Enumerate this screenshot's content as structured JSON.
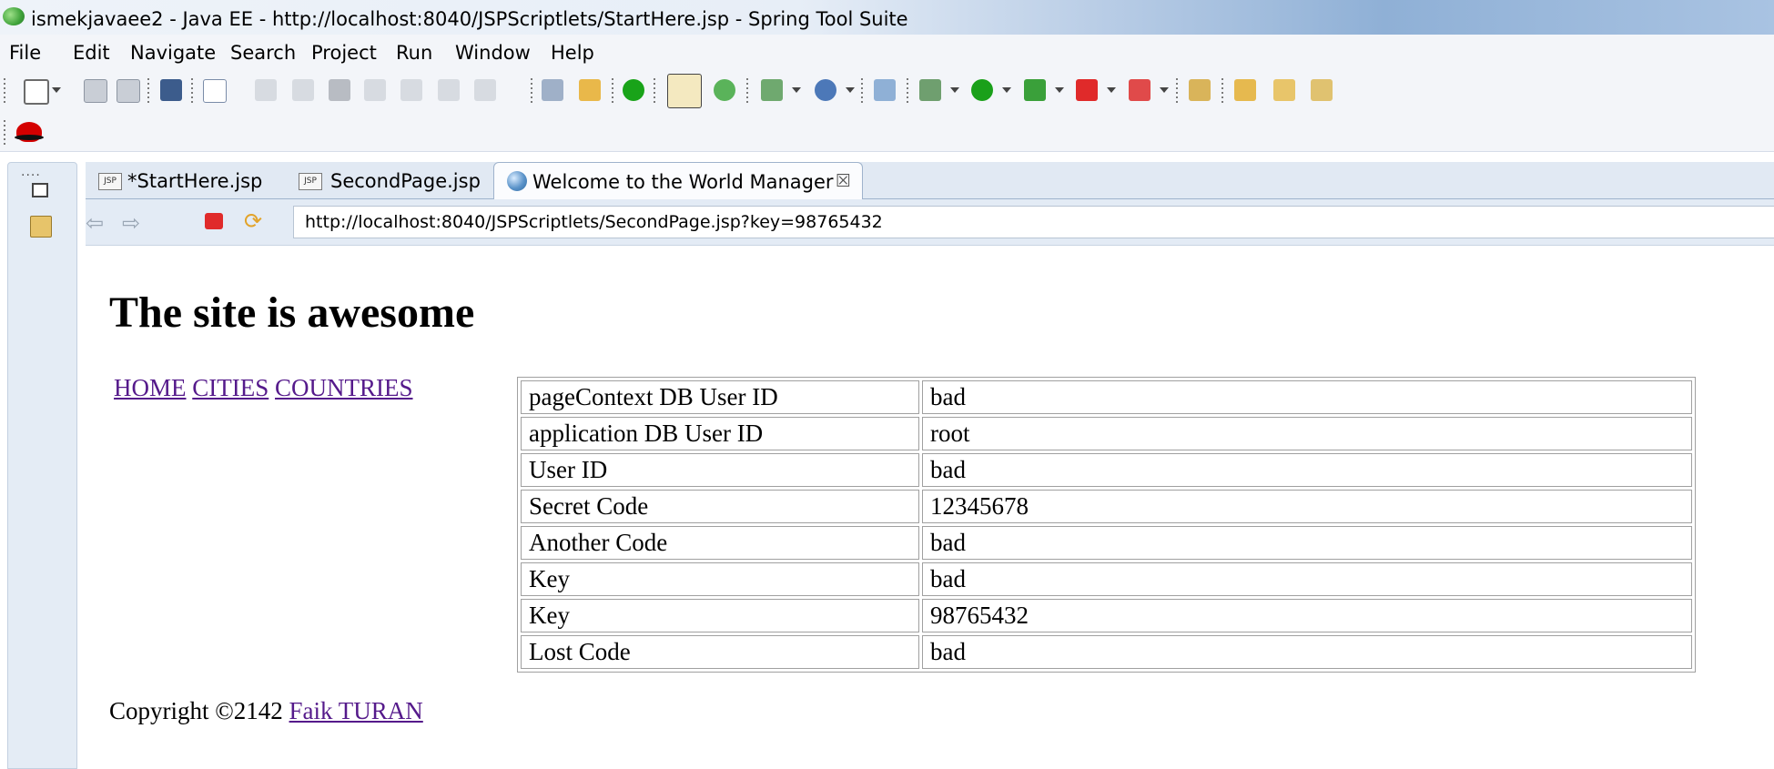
{
  "window": {
    "title": "ismekjavaee2 - Java EE - http://localhost:8040/JSPScriptlets/StartHere.jsp - Spring Tool Suite"
  },
  "menu": [
    "File",
    "Edit",
    "Navigate",
    "Search",
    "Project",
    "Run",
    "Window",
    "Help"
  ],
  "toolbar_icons": [
    "new-icon",
    "save-icon",
    "save-all-icon",
    "console-icon",
    "skip-breakpoints-icon",
    "resume-icon",
    "suspend-icon",
    "terminate-icon",
    "disconnect-icon",
    "step-into-icon",
    "step-over-icon",
    "step-return-icon",
    "drop-to-frame-icon",
    "use-step-filters-icon",
    "start-server-icon",
    "toggle-mark-occurrences-icon",
    "spring-icon",
    "new-spring-project-icon",
    "spring-dropdown-icon",
    "search-icon",
    "debug-icon",
    "run-icon",
    "coverage-icon",
    "stop-icon",
    "external-tools-icon",
    "open-type-icon",
    "open-folder-icon",
    "open-task-icon",
    "pin-icon",
    "redhat-icon"
  ],
  "tabs": [
    {
      "label": "*StartHere.jsp",
      "icon": "jsp-file-icon",
      "active": false
    },
    {
      "label": "SecondPage.jsp",
      "icon": "jsp-file-icon",
      "active": false
    },
    {
      "label": "Welcome to the World Manager",
      "icon": "globe-icon",
      "active": true
    }
  ],
  "browser": {
    "url": "http://localhost:8040/JSPScriptlets/SecondPage.jsp?key=98765432"
  },
  "page": {
    "heading": "The site is awesome",
    "nav_links": [
      "HOME",
      "CITIES",
      "COUNTRIES"
    ],
    "table_rows": [
      {
        "label": "pageContext DB User ID",
        "value": "bad"
      },
      {
        "label": "application DB User ID",
        "value": "root"
      },
      {
        "label": "User ID",
        "value": "bad"
      },
      {
        "label": "Secret Code",
        "value": "12345678"
      },
      {
        "label": "Another Code",
        "value": "bad"
      },
      {
        "label": "Key",
        "value": "bad"
      },
      {
        "label": "Key",
        "value": "98765432"
      },
      {
        "label": "Lost Code",
        "value": "bad"
      }
    ],
    "copyright_text": "Copyright ©2142",
    "copyright_author": "Faik TURAN"
  },
  "colors": {
    "visited_link": "#551a8b",
    "title_bar_accent": "#8fb0d6",
    "stop_red": "#e02a2a"
  }
}
